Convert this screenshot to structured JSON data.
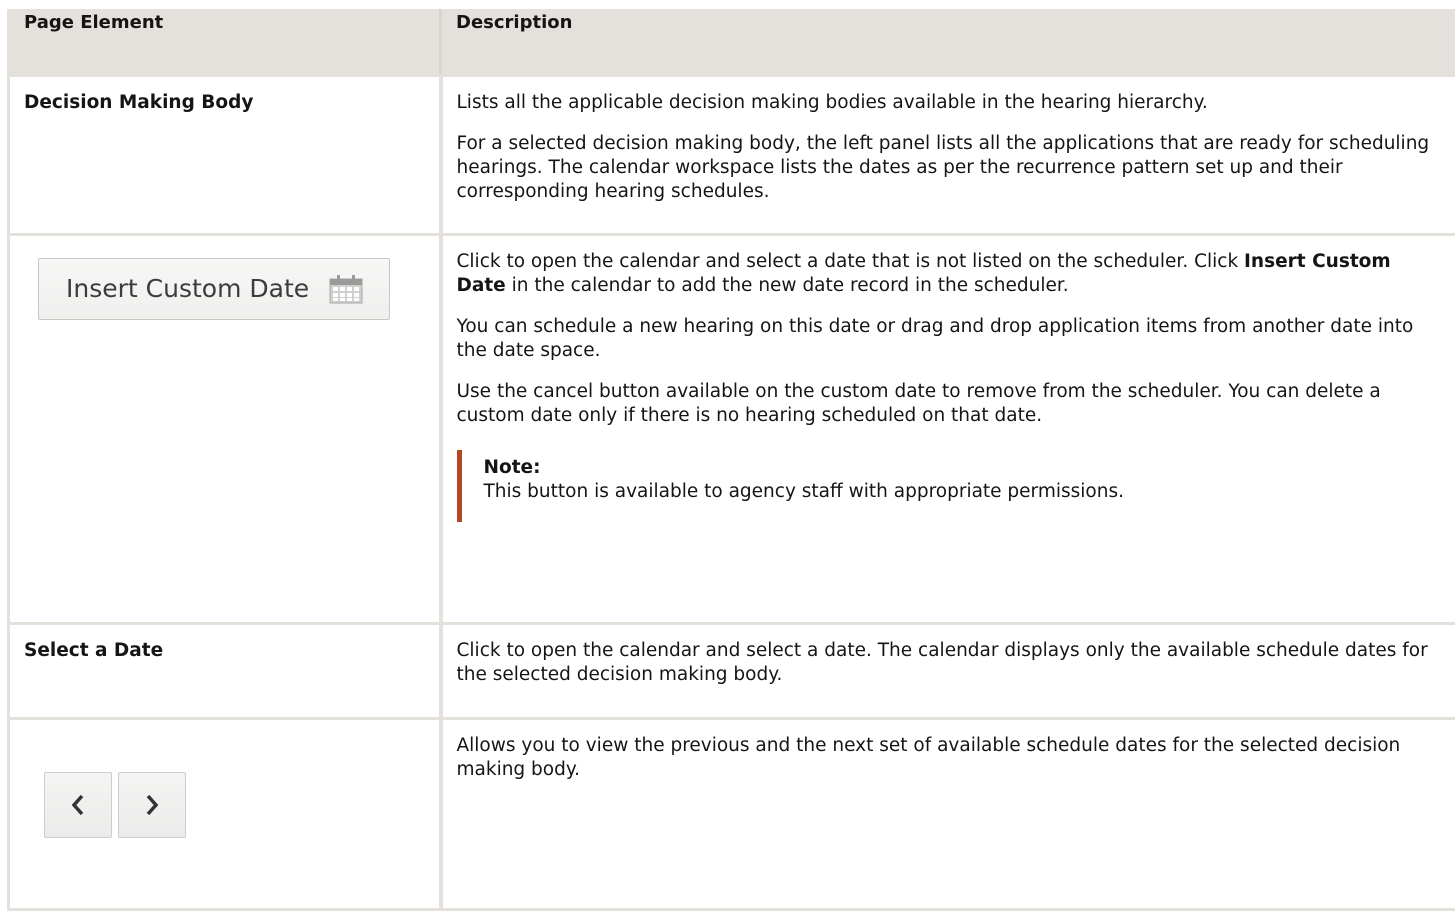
{
  "table": {
    "headers": [
      "Page Element",
      "Description"
    ],
    "rows": [
      {
        "element_label": "Decision Making Body",
        "paragraphs": [
          "Lists all the applicable decision making bodies available in the hearing hierarchy.",
          "For a selected decision making body, the left panel lists all the applications that are ready for scheduling hearings. The calendar workspace lists the dates as per the recurrence pattern set up and their corresponding hearing schedules."
        ]
      },
      {
        "element_button": {
          "label": "Insert Custom Date",
          "icon": "calendar-icon"
        },
        "para1_prefix": "Click to open the calendar and select a date that is not listed on the scheduler. Click ",
        "para1_bold": "Insert Custom Date",
        "para1_suffix": " in the calendar to add the new date record in the scheduler.",
        "paragraphs": [
          "You can schedule a new hearing on this date or drag and drop application items from another date into the date space.",
          "Use the cancel button available on the custom date to remove from the scheduler. You can delete a custom date only if there is no hearing scheduled on that date."
        ],
        "note": {
          "title": "Note:",
          "text": "This button is available to agency staff with appropriate permissions."
        }
      },
      {
        "element_label": "Select a Date",
        "paragraphs": [
          "Click to open the calendar and select a date. The calendar displays only the available schedule dates for the selected decision making body."
        ]
      },
      {
        "element_buttons": [
          {
            "icon": "chevron-left-icon"
          },
          {
            "icon": "chevron-right-icon"
          }
        ],
        "paragraphs": [
          "Allows you to view the previous and the next set of available schedule dates for the selected decision making body."
        ]
      }
    ]
  }
}
